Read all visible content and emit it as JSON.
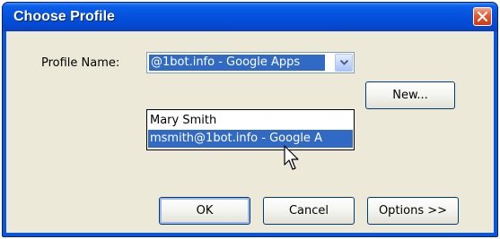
{
  "window": {
    "title": "Choose Profile",
    "accent_color": "#0552dc",
    "close_icon": "close-icon"
  },
  "form": {
    "profile_label": "Profile Name:",
    "selected_value": "@1bot.info - Google Apps",
    "dropdown_icon": "chevron-down-icon",
    "options": [
      "Mary Smith",
      "msmith@1bot.info - Google A"
    ],
    "highlighted_option_index": 1,
    "highlight_color": "#316ac5"
  },
  "buttons": {
    "new_label": "New...",
    "ok_label": "OK",
    "cancel_label": "Cancel",
    "options_label": "Options >>"
  },
  "cursor": {
    "icon": "arrow-cursor-icon"
  }
}
